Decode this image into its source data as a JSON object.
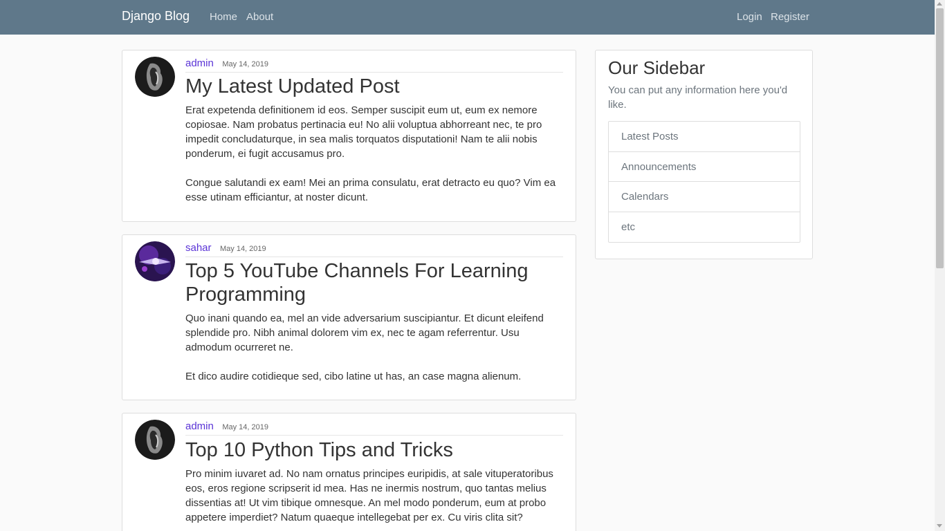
{
  "navbar": {
    "brand": "Django Blog",
    "links": [
      "Home",
      "About"
    ],
    "auth_links": [
      "Login",
      "Register"
    ]
  },
  "posts": [
    {
      "author": "admin",
      "date": "May 14, 2019",
      "title": "My Latest Updated Post",
      "paragraphs": [
        "Erat expetenda definitionem id eos. Semper suscipit eum ut, eum ex nemore copiosae. Nam probatus pertinacia eu! No alii voluptua abhorreant nec, te pro impedit concludaturque, in sea malis torquatos disputationi! Nam te alii nobis ponderum, ei fugit accusamus pro.",
        "Congue salutandi ex eam! Mei an prima consulatu, erat detracto eu quo? Vim ea esse utinam efficiantur, at noster dicunt."
      ]
    },
    {
      "author": "sahar",
      "date": "May 14, 2019",
      "title": "Top 5 YouTube Channels For Learning Programming",
      "paragraphs": [
        "Quo inani quando ea, mel an vide adversarium suscipiantur. Et dicunt eleifend splendide pro. Nibh animal dolorem vim ex, nec te agam referrentur. Usu admodum ocurreret ne.",
        "Et dico audire cotidieque sed, cibo latine ut has, an case magna alienum."
      ]
    },
    {
      "author": "admin",
      "date": "May 14, 2019",
      "title": "Top 10 Python Tips and Tricks",
      "paragraphs": [
        "Pro minim iuvaret ad. No nam ornatus principes euripidis, at sale vituperatoribus eos, eros regione scripserit id mea. Has ne inermis nostrum, quo tantas melius dissentias at! Ut vim tibique omnesque. An mel modo ponderum, eum at probo appetere imperdiet? Natum quaeque intellegebat per ex. Cu viris clita sit?"
      ]
    }
  ],
  "sidebar": {
    "title": "Our Sidebar",
    "description": "You can put any information here you'd like.",
    "items": [
      "Latest Posts",
      "Announcements",
      "Calendars",
      "etc"
    ]
  }
}
